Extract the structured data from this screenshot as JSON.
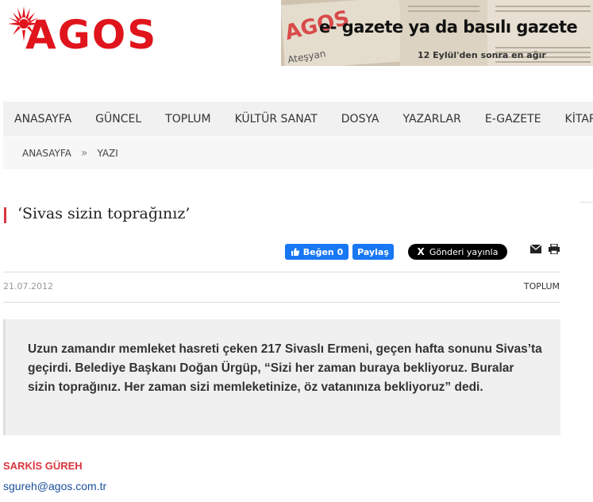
{
  "header": {
    "logo_text": "AGOS",
    "banner": {
      "masthead": "AGOS",
      "headline": "e- gazete ya da basılı gazete",
      "paper_snippets": [
        "Ateşyan",
        "12 Eylül'den sonra en ağır"
      ]
    }
  },
  "nav": {
    "items": [
      "ANASAYFA",
      "GÜNCEL",
      "TOPLUM",
      "KÜLTÜR SANAT",
      "DOSYA",
      "YAZARLAR",
      "E-GAZETE",
      "KİTAP ԳՐՐ"
    ]
  },
  "breadcrumb": {
    "home": "ANASAYFA",
    "separator": "»",
    "current": "YAZI"
  },
  "article": {
    "title": "‘Sivas sizin toprağınız’",
    "date": "21.07.2012",
    "category": "TOPLUM",
    "summary": "Uzun zamandır memleket hasreti çeken 217 Sivaslı Ermeni, geçen hafta sonunu Sivas’ta geçirdi. Belediye Başkanı Doğan Ürgüp, “Sizi her zaman buraya bekliyoruz. Buralar sizin toprağınız. Her zaman sizi memleketinize, öz vatanınıza bekliyoruz” dedi.",
    "author": "SARKİS GÜREH",
    "email": "sgureh@agos.com.tr"
  },
  "share": {
    "fb_like": "Beğen 0",
    "fb_share": "Paylaş",
    "x_post": "Gönderi yayınla",
    "x_mark": "X"
  },
  "colors": {
    "brand_red": "#e0141c",
    "accent_red": "#d9363e",
    "facebook_blue": "#1877f2",
    "link_blue": "#1a4f9c"
  },
  "icons": [
    "sunburst-logo-icon",
    "facebook-thumb-icon",
    "mail-icon",
    "print-icon"
  ]
}
